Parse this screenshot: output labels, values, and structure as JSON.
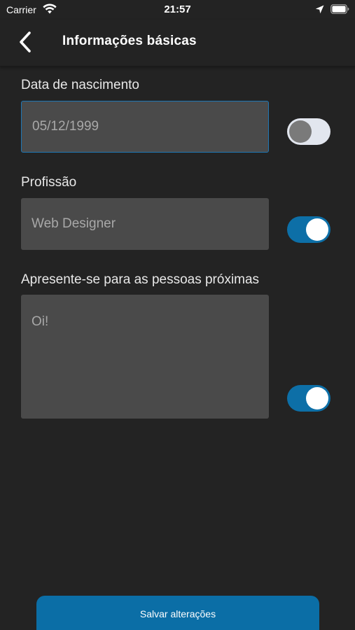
{
  "status_bar": {
    "carrier": "Carrier",
    "time": "21:57",
    "icons": [
      "wifi-icon",
      "location-icon",
      "battery-icon"
    ]
  },
  "nav": {
    "title": "Informações básicas",
    "back_icon": "chevron-left-icon"
  },
  "fields": [
    {
      "label": "Data de nascimento",
      "value": "05/12/1999",
      "focused": true,
      "visible_toggle_on": false
    },
    {
      "label": "Profissão",
      "value": "Web Designer",
      "focused": false,
      "visible_toggle_on": true
    },
    {
      "label": "Apresente-se para as pessoas próximas",
      "value": "Oi!",
      "focused": false,
      "visible_toggle_on": true
    }
  ],
  "save_button": {
    "label": "Salvar alterações"
  },
  "colors": {
    "background": "#232323",
    "field_background": "#4a4a4a",
    "accent": "#0b6ea6",
    "focus_border": "#1f77b4",
    "toggle_off_track": "#e2e6ee"
  }
}
